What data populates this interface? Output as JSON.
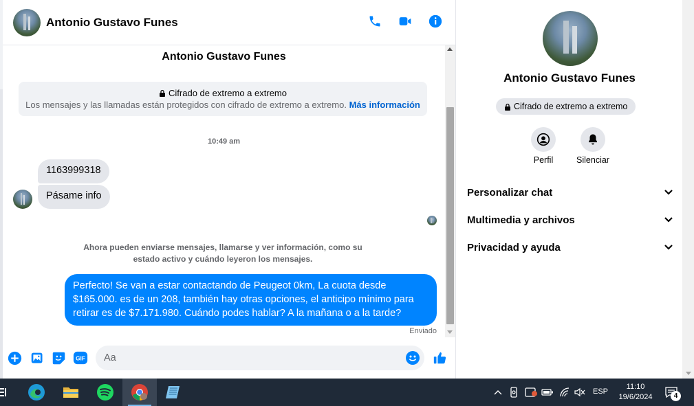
{
  "contact": {
    "name": "Antonio Gustavo Funes"
  },
  "header": {
    "icons": [
      "phone-icon",
      "video-camera-icon",
      "info-icon"
    ],
    "accent": "#0084ff"
  },
  "conversation": {
    "title": "Antonio Gustavo Funes",
    "e2e_card": {
      "title": "Cifrado de extremo a extremo",
      "body": "Los mensajes y las llamadas están protegidos con cifrado de extremo a extremo.",
      "link": "Más información"
    },
    "timestamp": "10:49 am",
    "incoming": [
      "1163999318",
      "Pásame info"
    ],
    "info_notice": "Ahora pueden enviarse mensajes, llamarse y ver información, como su estado activo y cuándo leyeron los mensajes.",
    "outgoing": "Perfecto!  Se van a estar contactando de Peugeot 0km, La cuota desde $165.000. es de un 208, también hay otras opciones, el anticipo mínimo para retirar es de $7.171.980. Cuándo podes hablar? A la mañana o a la tarde?",
    "status": "Enviado"
  },
  "composer": {
    "placeholder": "Aa",
    "icons": [
      "plus-circle-icon",
      "image-icon",
      "sticker-icon",
      "gif-icon",
      "emoji-icon",
      "like-icon"
    ],
    "gif_label": "GIF"
  },
  "panel": {
    "name": "Antonio Gustavo Funes",
    "badge": "Cifrado de extremo a extremo",
    "actions": [
      {
        "label": "Perfil",
        "icon": "profile-icon"
      },
      {
        "label": "Silenciar",
        "icon": "bell-icon"
      }
    ],
    "sections": [
      "Personalizar chat",
      "Multimedia y archivos",
      "Privacidad y ayuda"
    ]
  },
  "taskbar": {
    "apps": [
      "edge-icon",
      "file-explorer-icon",
      "spotify-icon",
      "chrome-icon",
      "notepad-icon"
    ],
    "language": "ESP",
    "time": "11:10",
    "date": "19/6/2024",
    "notifications": "4",
    "colors": {
      "bg": "#1f2a38",
      "active": "#3a4554"
    }
  }
}
